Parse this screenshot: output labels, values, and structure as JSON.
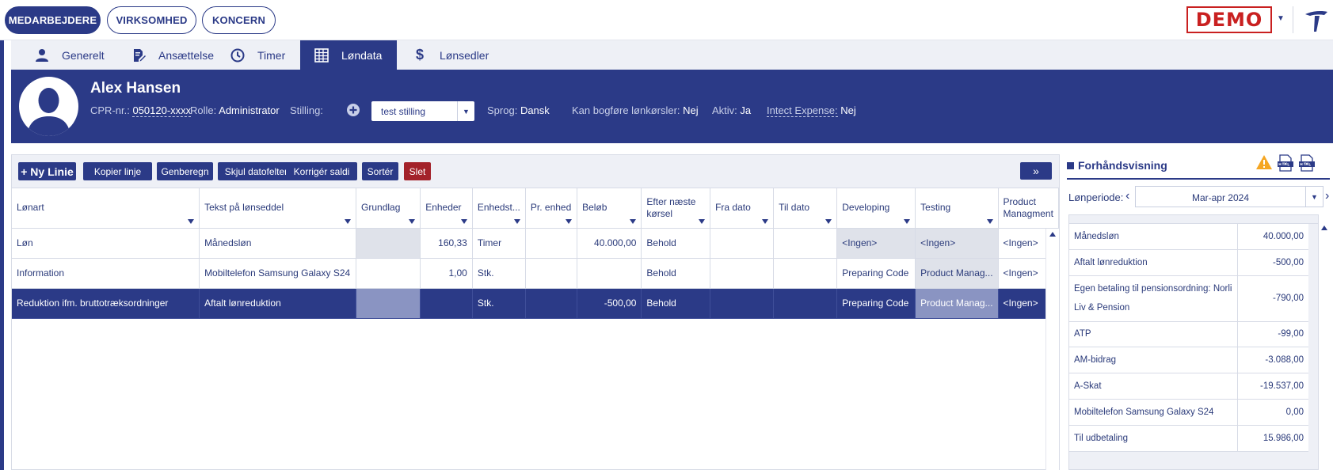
{
  "top_nav": {
    "items": [
      "MEDARBEJDERE",
      "VIRKSOMHED",
      "KONCERN"
    ],
    "active": 0
  },
  "demo_badge": "DEMO",
  "tabs": [
    {
      "label": "Generelt",
      "icon": "person-icon"
    },
    {
      "label": "Ansættelse",
      "icon": "document-edit-icon"
    },
    {
      "label": "Timer",
      "icon": "clock-icon"
    },
    {
      "label": "Løndata",
      "icon": "table-grid-icon"
    },
    {
      "label": "Lønsedler",
      "icon": "dollar-icon"
    }
  ],
  "active_tab": 3,
  "profile": {
    "name": "Alex Hansen",
    "cpr_label": "CPR-nr.:",
    "cpr_value": "050120-xxxx",
    "role_label": "Rolle:",
    "role_value": "Administrator",
    "position_label": "Stilling:",
    "position_value": "test stilling",
    "language_label": "Sprog:",
    "language_value": "Dansk",
    "payroll_label": "Kan bogføre lønkørsler:",
    "payroll_value": "Nej",
    "active_label": "Aktiv:",
    "active_value": "Ja",
    "expense_label": "Intect Expense:",
    "expense_value": "Nej"
  },
  "toolbar": {
    "new_line": "+ Ny Linie",
    "copy_line": "Kopier linje",
    "recalc": "Genberegn",
    "hide_date": "Skjul datofelter",
    "correct_balance": "Korrigér saldi",
    "sort": "Sortér",
    "delete": "Slet",
    "expand": "»"
  },
  "grid": {
    "columns": [
      "Lønart",
      "Tekst på lønseddel",
      "Grundlag",
      "Enheder",
      "Enhedst...",
      "Pr. enhed",
      "Beløb",
      "Efter næste kørsel",
      "Fra dato",
      "Til dato",
      "Developing",
      "Testing",
      "Product Managment"
    ],
    "rows": [
      [
        "Løn",
        "Månedsløn",
        "",
        "160,33",
        "Timer",
        "",
        "40.000,00",
        "Behold",
        "",
        "",
        "<Ingen>",
        "<Ingen>",
        "<Ingen>"
      ],
      [
        "Information",
        "Mobiltelefon Samsung Galaxy S24",
        "",
        "1,00",
        "Stk.",
        "",
        "",
        "Behold",
        "",
        "",
        "Preparing Code",
        "Product Manag...",
        "<Ingen>"
      ],
      [
        "Reduktion ifm. bruttotræksordninger",
        "Aftalt lønreduktion",
        "",
        "",
        "Stk.",
        "",
        "-500,00",
        "Behold",
        "",
        "",
        "Preparing Code",
        "Product Manag...",
        "<Ingen>"
      ]
    ],
    "selected_row": 2
  },
  "preview": {
    "title": "Forhåndsvisning",
    "period_label": "Lønperiode:",
    "period_value": "Mar-apr 2024",
    "rows": [
      {
        "label": "Månedsløn",
        "value": "40.000,00"
      },
      {
        "label": "Aftalt lønreduktion",
        "value": "-500,00"
      },
      {
        "label": "Egen betaling til pensionsordning: Norli Liv & Pension",
        "value": "-790,00"
      },
      {
        "label": "ATP",
        "value": "-99,00"
      },
      {
        "label": "AM-bidrag",
        "value": "-3.088,00"
      },
      {
        "label": "A-Skat",
        "value": "-19.537,00"
      },
      {
        "label": "Mobiltelefon Samsung Galaxy S24",
        "value": "0,00"
      },
      {
        "label": "Til udbetaling",
        "value": "15.986,00"
      }
    ]
  },
  "colors": {
    "primary": "#2b3a87",
    "danger": "#a3222a",
    "demo": "#c92020",
    "warning": "#f5a623"
  }
}
